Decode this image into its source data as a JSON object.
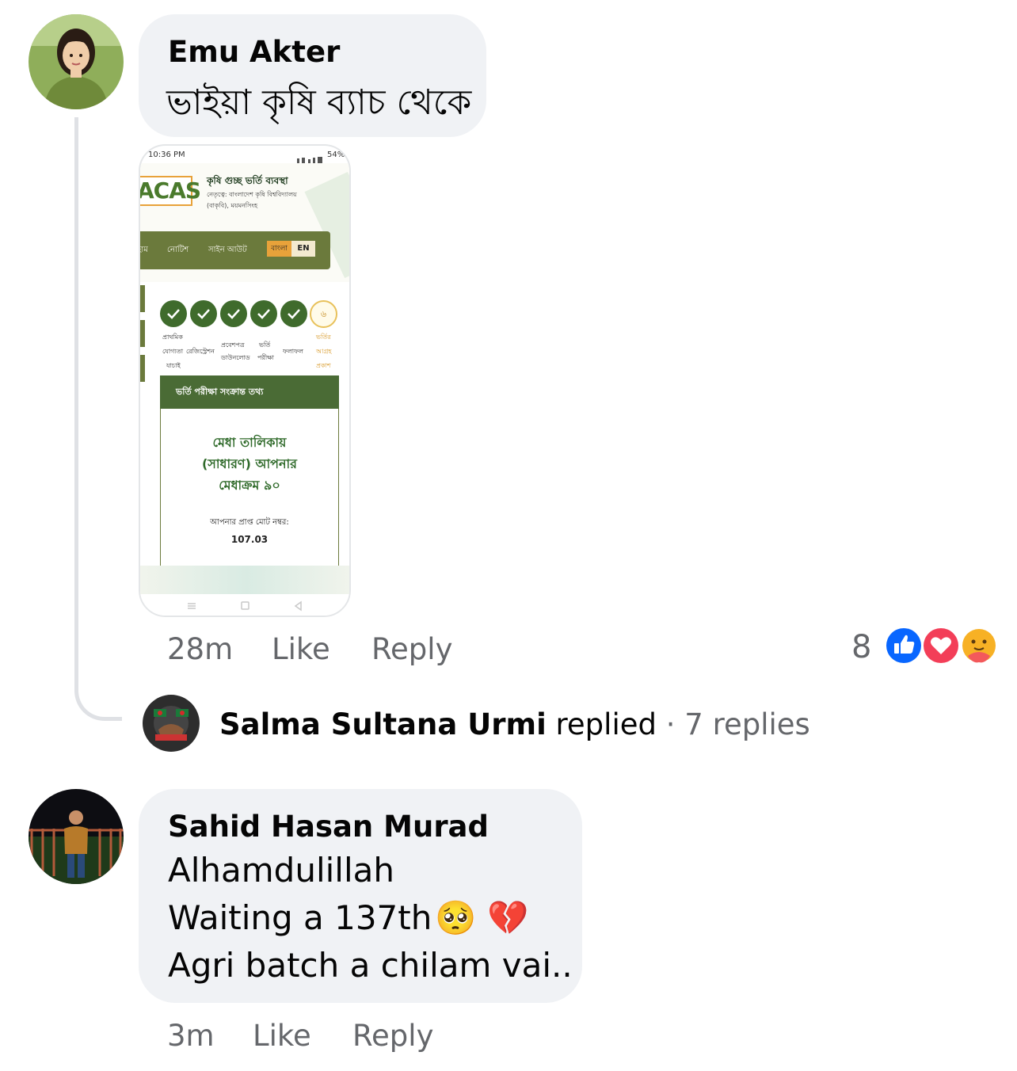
{
  "comment1": {
    "author": "Emu Akter",
    "text": "ভাইয়া কৃষি ব্যাচ থেকে",
    "time": "28m",
    "like_label": "Like",
    "reply_label": "Reply",
    "reaction_count": "8",
    "reactions": [
      "like-icon",
      "love-icon",
      "care-icon"
    ]
  },
  "attachment": {
    "status_time": "10:36 PM",
    "status_battery": "54%",
    "logo": "ACAS",
    "site_title": "কৃষি গুচ্ছ ভর্তি ব্যবস্থা",
    "site_sub1": "নেতৃত্বে: বাংলাদেশ কৃষি বিশ্ববিদ্যালয়",
    "site_sub2": "(বাকৃবি), ময়মনসিংহ",
    "nav": {
      "home": "হোম",
      "notice": "নোটিশ",
      "signout": "সাইন আউট",
      "lang_bn": "বাংলা",
      "lang_en": "EN"
    },
    "step_six": "৬",
    "steps": {
      "s1a": "প্রাথমিক",
      "s1b": "যোগ্যতা",
      "s1c": "যাচাই",
      "s2": "রেজিস্ট্রেশন",
      "s3a": "প্রবেশপত্র",
      "s3b": "ডাউনলোড",
      "s4a": "ভর্তি",
      "s4b": "পরীক্ষা",
      "s5": "ফলাফল",
      "s6a": "ভর্তির",
      "s6b": "আগ্রহ",
      "s6c": "প্রকাশ"
    },
    "card_header": "ভর্তি পরীক্ষা সংক্রান্ত তথ্য",
    "merit_line1": "মেধা তালিকায়",
    "merit_line2": "(সাধারণ) আপনার",
    "merit_line3": "মেধাক্রম ৯০",
    "marks_label": "আপনার প্রাপ্ত মোট নম্বর:",
    "marks_value": "107.03"
  },
  "reply_summary": {
    "name": "Salma Sultana Urmi",
    "verb": "replied",
    "dot": "·",
    "count": "7 replies"
  },
  "comment2": {
    "author": "Sahid Hasan Murad",
    "line1": "Alhamdulillah",
    "line2_text": "Waiting a 137th",
    "line2_emoji1": "🥺",
    "line2_emoji2": "💔",
    "line3": "Agri batch a chilam vai..",
    "time": "3m",
    "like_label": "Like",
    "reply_label": "Reply"
  },
  "colors": {
    "bubble": "#f0f2f5",
    "secondary_text": "#65676b",
    "like_blue": "#0866ff",
    "love_red": "#f33e58",
    "acas_green": "#4a6b35",
    "orange": "#e8a23a"
  }
}
